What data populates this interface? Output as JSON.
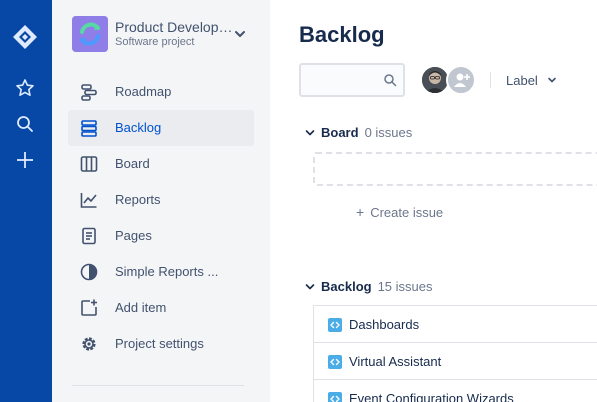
{
  "project": {
    "name": "Product Development",
    "type": "Software project"
  },
  "sidebar": {
    "items": [
      {
        "label": "Roadmap",
        "icon": "roadmap-icon"
      },
      {
        "label": "Backlog",
        "icon": "backlog-icon",
        "active": true
      },
      {
        "label": "Board",
        "icon": "board-icon"
      },
      {
        "label": "Reports",
        "icon": "reports-icon"
      },
      {
        "label": "Pages",
        "icon": "pages-icon"
      },
      {
        "label": "Simple Reports ...",
        "icon": "pie-chart-icon"
      },
      {
        "label": "Add item",
        "icon": "add-item-icon"
      },
      {
        "label": "Project settings",
        "icon": "gear-icon"
      }
    ]
  },
  "global_nav": {
    "icons": [
      "jira-logo-icon",
      "star-icon",
      "search-icon",
      "plus-icon"
    ]
  },
  "main": {
    "title": "Backlog",
    "search": {
      "value": "",
      "placeholder": ""
    },
    "label_filter": "Label",
    "board_section": {
      "name": "Board",
      "count": "0 issues"
    },
    "create_issue": "Create issue",
    "backlog_section": {
      "name": "Backlog",
      "count": "15 issues"
    },
    "issues": [
      {
        "summary": "Dashboards"
      },
      {
        "summary": "Virtual Assistant"
      },
      {
        "summary": "Event Configuration Wizards"
      }
    ]
  },
  "colors": {
    "global_nav_bg": "#0747a6",
    "sidebar_bg": "#f4f5f7",
    "active_text": "#0052cc",
    "story_icon": "#4bade8",
    "project_avatar": "#8f7ee7"
  }
}
